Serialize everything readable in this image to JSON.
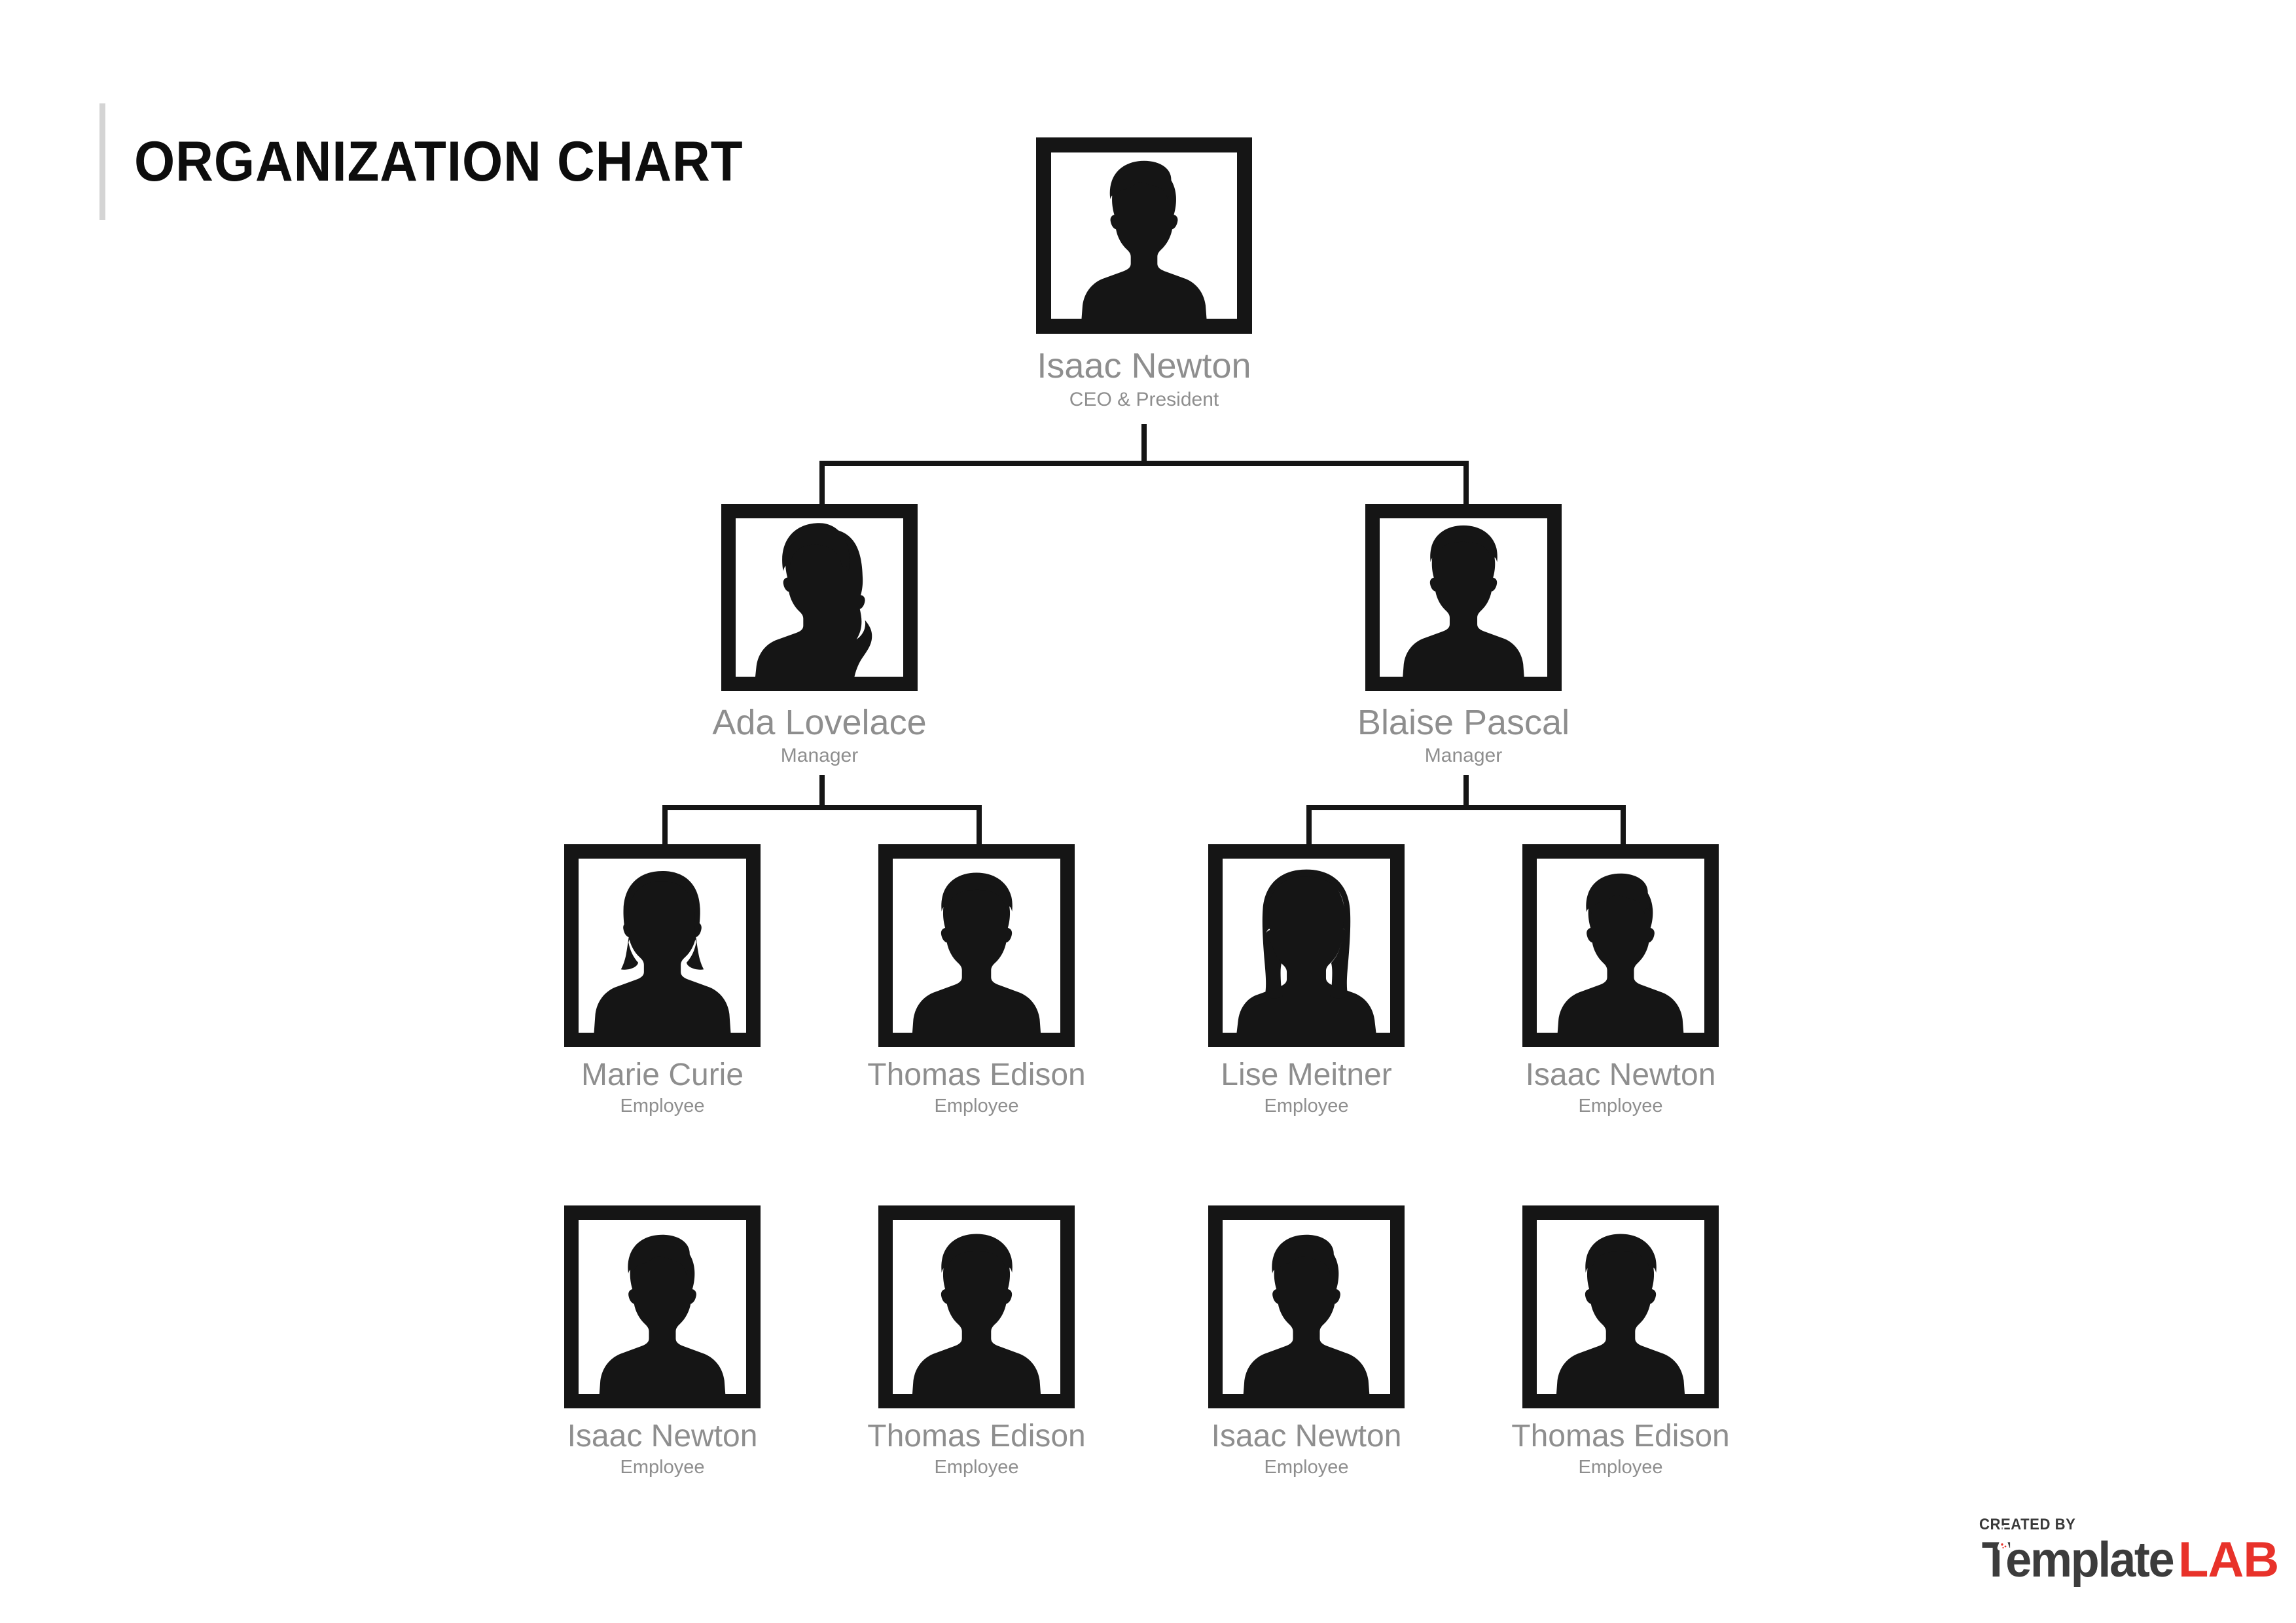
{
  "page": {
    "title": "ORGANIZATION CHART",
    "background_color": "#ffffff",
    "title_color": "#0d0d0d",
    "title_rule_color": "#d4d4d4",
    "name_color": "#8e8e8e",
    "role_color": "#8e8e8e",
    "frame_color": "#151515",
    "connector_color": "#151515"
  },
  "chart_data": {
    "type": "diagram",
    "subtype": "organization-chart",
    "title": "ORGANIZATION CHART",
    "levels": [
      {
        "level": 1,
        "role_label": "CEO & President",
        "nodes": [
          {
            "id": "n1",
            "name": "Isaac Newton",
            "title": "CEO & President",
            "avatar": "avatar-male-curly",
            "parent": null
          }
        ]
      },
      {
        "level": 2,
        "role_label": "Manager",
        "nodes": [
          {
            "id": "n2",
            "name": "Ada Lovelace",
            "title": "Manager",
            "avatar": "avatar-female-ponytail",
            "parent": "n1"
          },
          {
            "id": "n3",
            "name": "Blaise Pascal",
            "title": "Manager",
            "avatar": "avatar-male-short",
            "parent": "n1"
          }
        ]
      },
      {
        "level": 3,
        "role_label": "Employee",
        "nodes": [
          {
            "id": "n4",
            "name": "Marie Curie",
            "title": "Employee",
            "avatar": "avatar-female-bob",
            "parent": "n2"
          },
          {
            "id": "n5",
            "name": "Thomas Edison",
            "title": "Employee",
            "avatar": "avatar-male-short",
            "parent": "n2"
          },
          {
            "id": "n6",
            "name": "Lise Meitner",
            "title": "Employee",
            "avatar": "avatar-female-long",
            "parent": "n3"
          },
          {
            "id": "n7",
            "name": "Isaac Newton",
            "title": "Employee",
            "avatar": "avatar-male-curly",
            "parent": "n3"
          }
        ]
      },
      {
        "level": 4,
        "role_label": "Employee",
        "nodes": [
          {
            "id": "n8",
            "name": "Isaac Newton",
            "title": "Employee",
            "avatar": "avatar-male-curly",
            "parent": null
          },
          {
            "id": "n9",
            "name": "Thomas Edison",
            "title": "Employee",
            "avatar": "avatar-male-short",
            "parent": null
          },
          {
            "id": "n10",
            "name": "Isaac Newton",
            "title": "Employee",
            "avatar": "avatar-male-curly",
            "parent": null
          },
          {
            "id": "n11",
            "name": "Thomas Edison",
            "title": "Employee",
            "avatar": "avatar-male-short",
            "parent": null
          }
        ]
      }
    ],
    "node_count": 11,
    "depth": 4
  },
  "nodes": {
    "ceo": {
      "name": "Isaac Newton",
      "title": "CEO & President"
    },
    "manager_left": {
      "name": "Ada Lovelace",
      "title": "Manager"
    },
    "manager_right": {
      "name": "Blaise Pascal",
      "title": "Manager"
    },
    "row3": [
      {
        "name": "Marie Curie",
        "title": "Employee"
      },
      {
        "name": "Thomas Edison",
        "title": "Employee"
      },
      {
        "name": "Lise Meitner",
        "title": "Employee"
      },
      {
        "name": "Isaac Newton",
        "title": "Employee"
      }
    ],
    "row4": [
      {
        "name": "Isaac Newton",
        "title": "Employee"
      },
      {
        "name": "Thomas Edison",
        "title": "Employee"
      },
      {
        "name": "Isaac Newton",
        "title": "Employee"
      },
      {
        "name": "Thomas Edison",
        "title": "Employee"
      }
    ]
  },
  "brand": {
    "created_by": "CREATED BY",
    "name_dark": "Template",
    "name_red": "LAB",
    "red": "#e8322a",
    "dark": "#3c3c3c"
  }
}
